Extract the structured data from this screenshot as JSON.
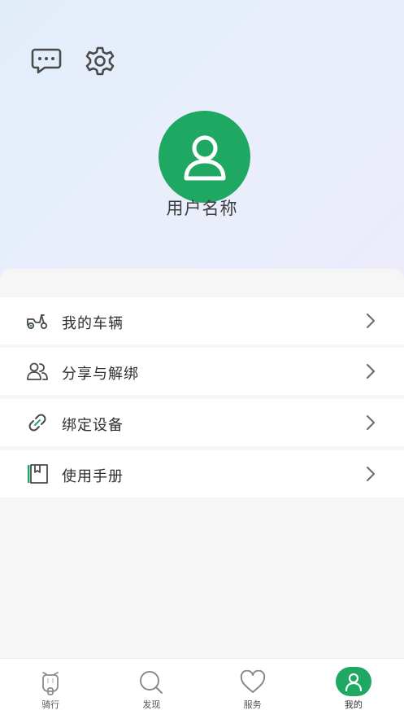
{
  "profile": {
    "username": "用户名称"
  },
  "icons": {
    "message": "message-icon",
    "settings": "gear-icon",
    "avatar": "user-avatar-icon"
  },
  "menu": [
    {
      "label": "我的车辆",
      "icon": "scooter-icon"
    },
    {
      "label": "分享与解绑",
      "icon": "users-icon"
    },
    {
      "label": "绑定设备",
      "icon": "link-icon"
    },
    {
      "label": "使用手册",
      "icon": "manual-icon"
    }
  ],
  "tabs": [
    {
      "label": "骑行",
      "icon": "ride-icon",
      "active": false
    },
    {
      "label": "发现",
      "icon": "discover-icon",
      "active": false
    },
    {
      "label": "服务",
      "icon": "heart-icon",
      "active": false
    },
    {
      "label": "我的",
      "icon": "profile-icon",
      "active": true
    }
  ],
  "colors": {
    "accent": "#1fa862",
    "text": "#2f2f2f",
    "muted": "#555555",
    "icon": "#4a4a4a"
  }
}
